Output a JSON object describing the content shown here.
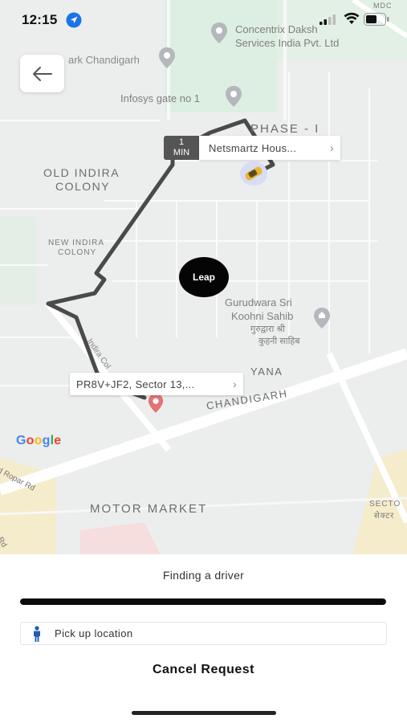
{
  "status": {
    "time": "12:15",
    "location_icon": "location-arrow-icon",
    "signal_icon": "cellular-signal-icon",
    "wifi_icon": "wifi-icon",
    "battery_icon": "battery-icon"
  },
  "map": {
    "back_icon": "arrow-left-icon",
    "labels": {
      "concentrix_line1": "Concentrix Daksh",
      "concentrix_line2": "Services India Pvt. Ltd",
      "park": "ark Chandigarh",
      "infosys": "Infosys gate no 1",
      "phase": "PHASE - I",
      "old_indira_1": "OLD INDIRA",
      "old_indira_2": "COLONY",
      "new_indira_1": "NEW INDIRA",
      "new_indira_2": "COLONY",
      "gurudwara_1": "Gurudwara Sri",
      "gurudwara_2": "Koohni Sahib",
      "gurudwara_3": "गुरुद्वारा श्री",
      "gurudwara_4": "कुहनी साहिब",
      "yana": "YANA",
      "chandigarh": "CHANDIGARH",
      "motor_market": "MOTOR MARKET",
      "ropar_1": "d Ropar Rd",
      "ropar_2": "c Rd",
      "sector_1": "SECTO",
      "sector_2": "सेक्टर",
      "mdc": "MDC",
      "road": "Indira Col"
    },
    "eta_value": "1",
    "eta_unit": "MIN",
    "destination": "Netsmartz Hous...",
    "pickup": "PR8V+JF2, Sector 13,...",
    "logo_text": "Leap",
    "google": "Google",
    "route_color": "#4a4a4a",
    "pin_color": "#e57373"
  },
  "sheet": {
    "status_text": "Finding a driver",
    "progress": 1.0,
    "pickup_label": "Pick up location",
    "pickup_icon": "person-icon",
    "cancel_label": "Cancel Request"
  }
}
